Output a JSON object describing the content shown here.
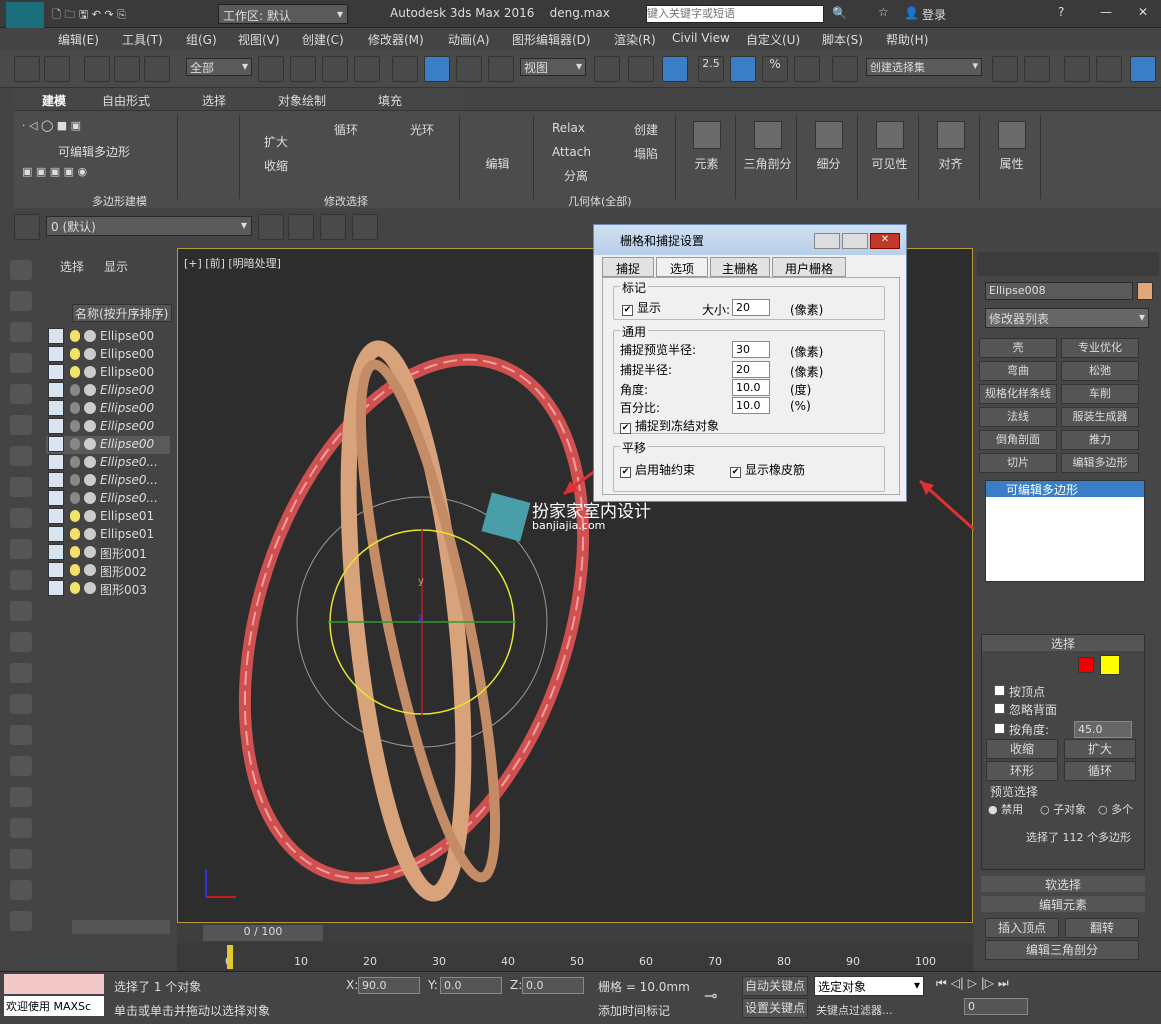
{
  "title": {
    "app": "Autodesk 3ds Max 2016",
    "file": "deng.max",
    "workspace": "工作区: 默认",
    "search_placeholder": "键入关键字或短语",
    "login": "登录",
    "logo": "MAX"
  },
  "menu": [
    "编辑(E)",
    "工具(T)",
    "组(G)",
    "视图(V)",
    "创建(C)",
    "修改器(M)",
    "动画(A)",
    "图形编辑器(D)",
    "渲染(R)",
    "Civil View",
    "自定义(U)",
    "脚本(S)",
    "帮助(H)"
  ],
  "toolbar": {
    "filter": "全部",
    "view": "视图",
    "snap25": "2.5",
    "percent": "%",
    "selset": "创建选择集"
  },
  "ribbon": {
    "tabs": [
      "建模",
      "自由形式",
      "选择",
      "对象绘制",
      "填充"
    ],
    "editpoly": "可编辑多边形",
    "polymodel": "多边形建模",
    "modsel": "修改选择",
    "geom": "几何体(全部)",
    "expand": "扩大",
    "shrink": "收缩",
    "loop": "循环",
    "ring": "光环",
    "edit": "编辑",
    "relax": "Relax",
    "attach": "Attach",
    "detach": "分离",
    "create": "创建",
    "collapse": "塌陷",
    "big": [
      "元素",
      "三角剖分",
      "细分",
      "可见性",
      "对齐",
      "属性"
    ]
  },
  "layer": "0 (默认)",
  "scene": {
    "tabs": [
      "选择",
      "显示"
    ],
    "header": "名称(按升序排序)",
    "items": [
      "Ellipse00",
      "Ellipse00",
      "Ellipse00",
      "Ellipse00",
      "Ellipse00",
      "Ellipse00",
      "Ellipse00",
      "Ellipse0...",
      "Ellipse0...",
      "Ellipse0...",
      "Ellipse01",
      "Ellipse01",
      "图形001",
      "图形002",
      "图形003"
    ]
  },
  "viewport": {
    "label": "[+] [前] [明暗处理]",
    "watermark": "扮家家室内设计",
    "watermark_url": "banjiajia.com",
    "axis_y": "y",
    "axis_z": "z"
  },
  "dialog": {
    "title": "栅格和捕捉设置",
    "tabs": [
      "捕捉",
      "选项",
      "主栅格",
      "用户栅格"
    ],
    "marker": "标记",
    "show": "显示",
    "size_label": "大小:",
    "size": "20",
    "px": "(像素)",
    "general": "通用",
    "preview_radius": "捕捉预览半径:",
    "preview_val": "30",
    "snap_radius": "捕捉半径:",
    "snap_val": "20",
    "angle": "角度:",
    "angle_val": "10.0",
    "deg": "(度)",
    "percent": "百分比:",
    "percent_val": "10.0",
    "pct": "(%)",
    "frozen": "捕捉到冻结对象",
    "translate": "平移",
    "axis_constraint": "启用轴约束",
    "rubber": "显示橡皮筋"
  },
  "cmd": {
    "objname": "Ellipse008",
    "modlist": "修改器列表",
    "mods": [
      "壳",
      "专业优化",
      "弯曲",
      "松弛",
      "规格化样条线",
      "车削",
      "法线",
      "服装生成器",
      "倒角剖面",
      "推力",
      "切片",
      "编辑多边形"
    ],
    "stack": "可编辑多边形",
    "rollout": "选择",
    "byvertex": "按顶点",
    "ignoreback": "忽略背面",
    "byangle": "按角度:",
    "angle": "45.0",
    "shrink": "收缩",
    "grow": "扩大",
    "ring": "环形",
    "loop": "循环",
    "preview": "预览选择",
    "off": "禁用",
    "subobj": "子对象",
    "multi": "多个",
    "selinfo": "选择了 112 个多边形",
    "softsel": "软选择",
    "editelem": "编辑元素",
    "insertv": "插入顶点",
    "flip": "翻转",
    "edittri": "编辑三角剖分"
  },
  "timeline": {
    "frame": "0 / 100",
    "ticks": [
      "0",
      "10",
      "20",
      "30",
      "40",
      "50",
      "60",
      "70",
      "80",
      "90",
      "100"
    ]
  },
  "status": {
    "welcome": "欢迎使用 MAXSc",
    "selected": "选择了 1 个对象",
    "hint": "单击或单击并拖动以选择对象",
    "x": "90.0",
    "y": "0.0",
    "z": "0.0",
    "grid": "栅格 = 10.0mm",
    "addtime": "添加时间标记",
    "autokey": "自动关键点",
    "setkey": "设置关键点",
    "selobj": "选定对象",
    "keyfilter": "关键点过滤器...",
    "frame": "0"
  }
}
